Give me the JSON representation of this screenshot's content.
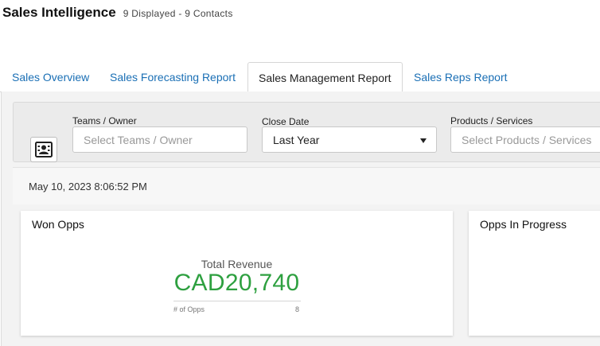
{
  "header": {
    "title": "Sales Intelligence",
    "subtitle": "9 Displayed - 9 Contacts"
  },
  "tabs": [
    {
      "label": "Sales Overview",
      "active": false
    },
    {
      "label": "Sales Forecasting Report",
      "active": false
    },
    {
      "label": "Sales Management Report",
      "active": true
    },
    {
      "label": "Sales Reps Report",
      "active": false
    }
  ],
  "filters": {
    "contact_icon": "contact-card-icon",
    "teams_owner": {
      "label": "Teams / Owner",
      "placeholder": "Select Teams / Owner"
    },
    "close_date": {
      "label": "Close Date",
      "value": "Last Year"
    },
    "products_services": {
      "label": "Products / Services",
      "placeholder": "Select Products / Services"
    }
  },
  "timestamp": "May 10, 2023 8:06:52 PM",
  "cards": {
    "won_opps": {
      "title": "Won Opps",
      "kpi_label": "Total Revenue",
      "kpi_value": "CAD20,740",
      "foot_label": "# of Opps",
      "foot_value": "8"
    },
    "opps_in_progress": {
      "title": "Opps In Progress"
    }
  },
  "colors": {
    "link": "#1a6fb5",
    "kpi_green": "#2ea040",
    "panel_bg": "#f3f3f3"
  }
}
